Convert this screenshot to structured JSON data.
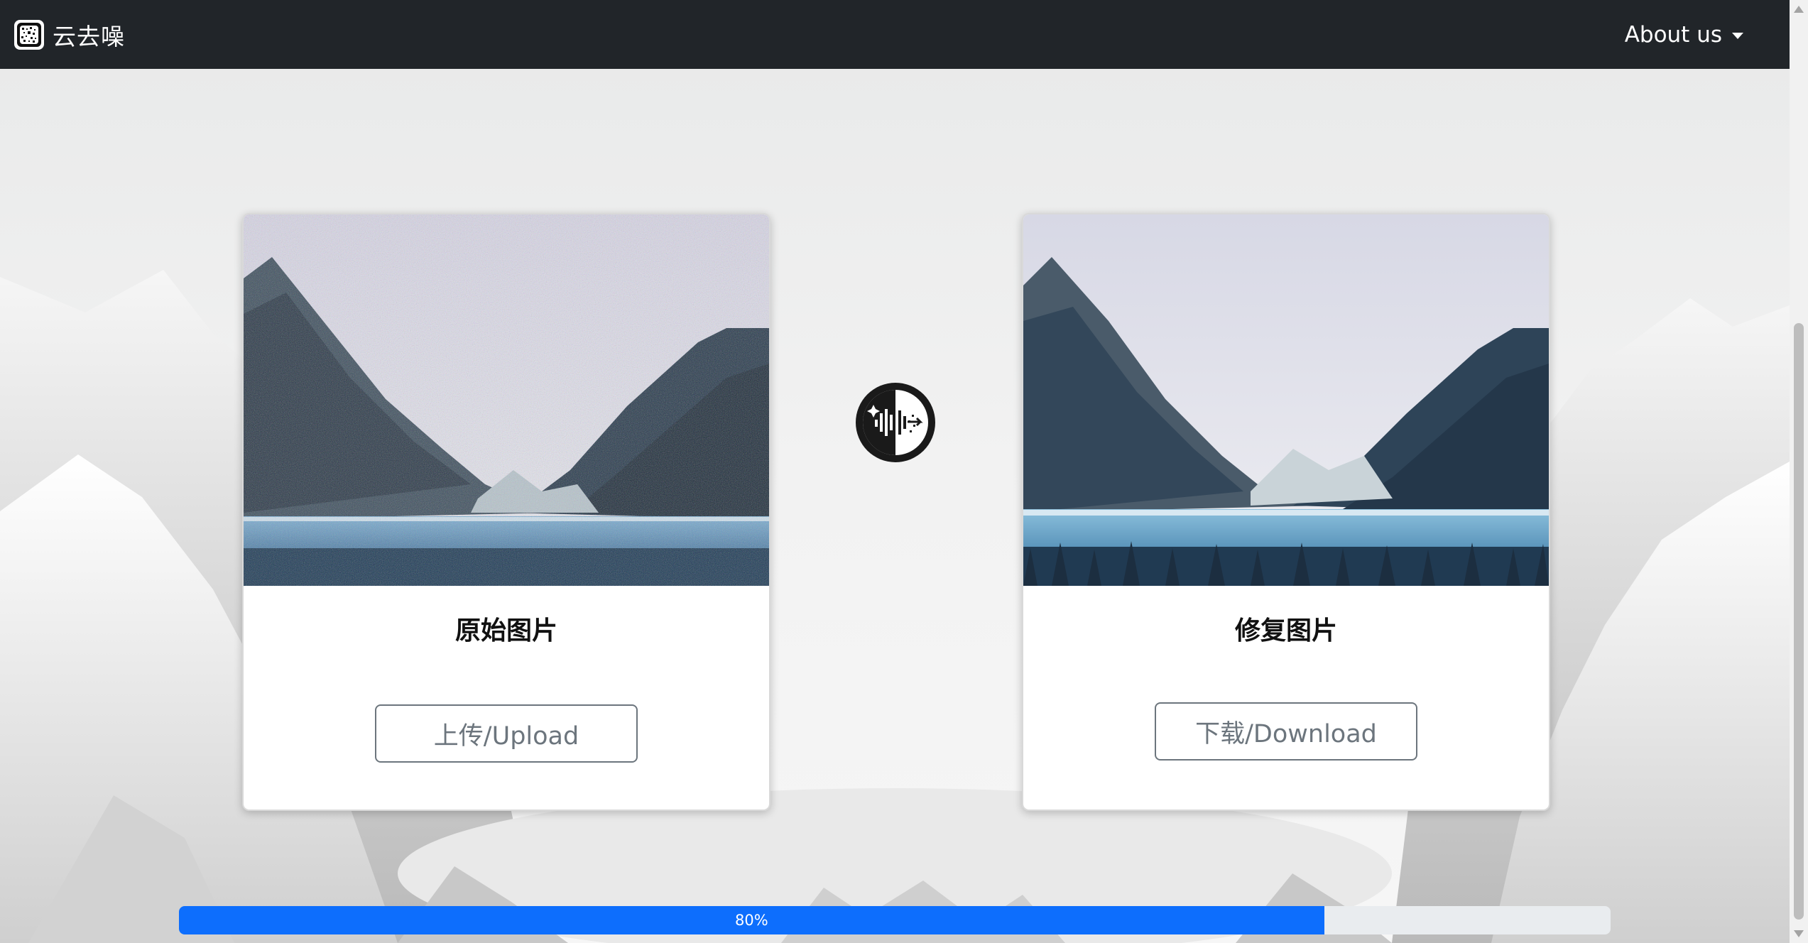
{
  "navbar": {
    "brand_name": "云去噪",
    "about_label": "About us"
  },
  "cards": {
    "original": {
      "title": "原始图片",
      "button_label": "上传/Upload"
    },
    "restored": {
      "title": "修复图片",
      "button_label": "下载/Download"
    }
  },
  "progress": {
    "label": "80%",
    "value_percent": 80
  },
  "colors": {
    "navbar_bg": "#212529",
    "progress_fill": "#0d6efd",
    "progress_track": "#e9ecef",
    "button_outline": "#6c757d"
  },
  "icons": {
    "brand": "noise-logo-icon",
    "center": "denoise-logo-icon",
    "dropdown": "caret-down-icon"
  }
}
